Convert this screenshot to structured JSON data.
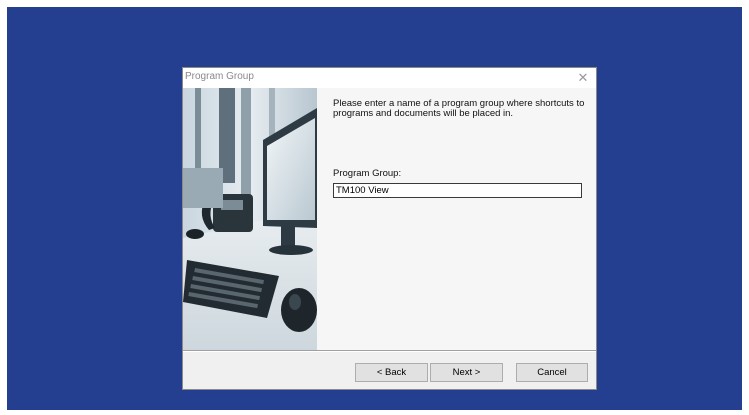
{
  "dialog": {
    "title": "Program Group",
    "close_glyph": "✕",
    "instructions": "Please enter a name of a program group where shortcuts to programs and documents will be placed in.",
    "field_label": "Program Group:",
    "field_value": "TM100 View",
    "buttons": {
      "back": "< Back",
      "next": "Next >",
      "cancel": "Cancel"
    },
    "side_image": "office-desk-illustration"
  },
  "colors": {
    "desktop": "#243f8f",
    "dialog_bg": "#f0f0f0",
    "content_bg": "#f6f6f6"
  }
}
